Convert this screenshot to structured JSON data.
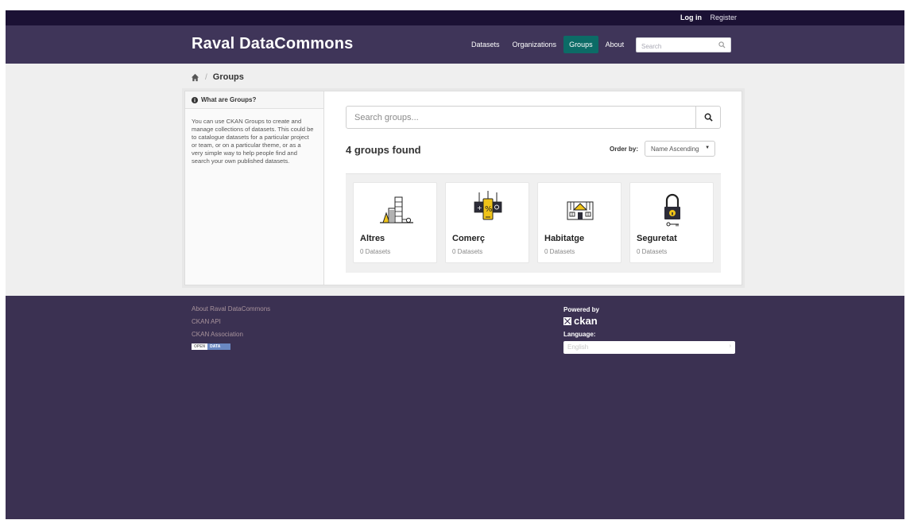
{
  "account": {
    "login": "Log in",
    "register": "Register"
  },
  "site": {
    "title": "Raval DataCommons"
  },
  "nav": [
    {
      "label": "Datasets",
      "active": false
    },
    {
      "label": "Organizations",
      "active": false
    },
    {
      "label": "Groups",
      "active": true
    },
    {
      "label": "About",
      "active": false
    }
  ],
  "site_search": {
    "placeholder": "Search",
    "icon": "search-icon"
  },
  "breadcrumb": {
    "home_icon": "home-icon",
    "current": "Groups"
  },
  "aside": {
    "heading": "What are Groups?",
    "icon": "info-icon",
    "body": "You can use CKAN Groups to create and manage collections of datasets. This could be to catalogue datasets for a particular project or team, or on a particular theme, or as a very simple way to help people find and search your own published datasets."
  },
  "group_search": {
    "placeholder": "Search groups...",
    "icon": "search-icon"
  },
  "results": {
    "count_text": "4 groups found"
  },
  "order": {
    "label": "Order by:",
    "selected": "Name Ascending"
  },
  "groups": [
    {
      "name": "Altres",
      "datasets": "0 Datasets",
      "icon": "buildings-icon"
    },
    {
      "name": "Comerç",
      "datasets": "0 Datasets",
      "icon": "shop-sign-icon"
    },
    {
      "name": "Habitatge",
      "datasets": "0 Datasets",
      "icon": "house-icon"
    },
    {
      "name": "Seguretat",
      "datasets": "0 Datasets",
      "icon": "padlock-icon"
    }
  ],
  "footer": {
    "links": [
      "About Raval DataCommons",
      "CKAN API",
      "CKAN Association"
    ],
    "open_data_badge": {
      "left": "OPEN",
      "right": "DATA"
    },
    "powered_by": "Powered by",
    "ckan": "ckan",
    "language_label": "Language:",
    "language_selected": "English"
  },
  "colors": {
    "topbar": "#1b1134",
    "masthead": "#3f3559",
    "footer": "#3b3152",
    "nav_active": "#0c6b66",
    "accent_yellow": "#f0c419"
  }
}
